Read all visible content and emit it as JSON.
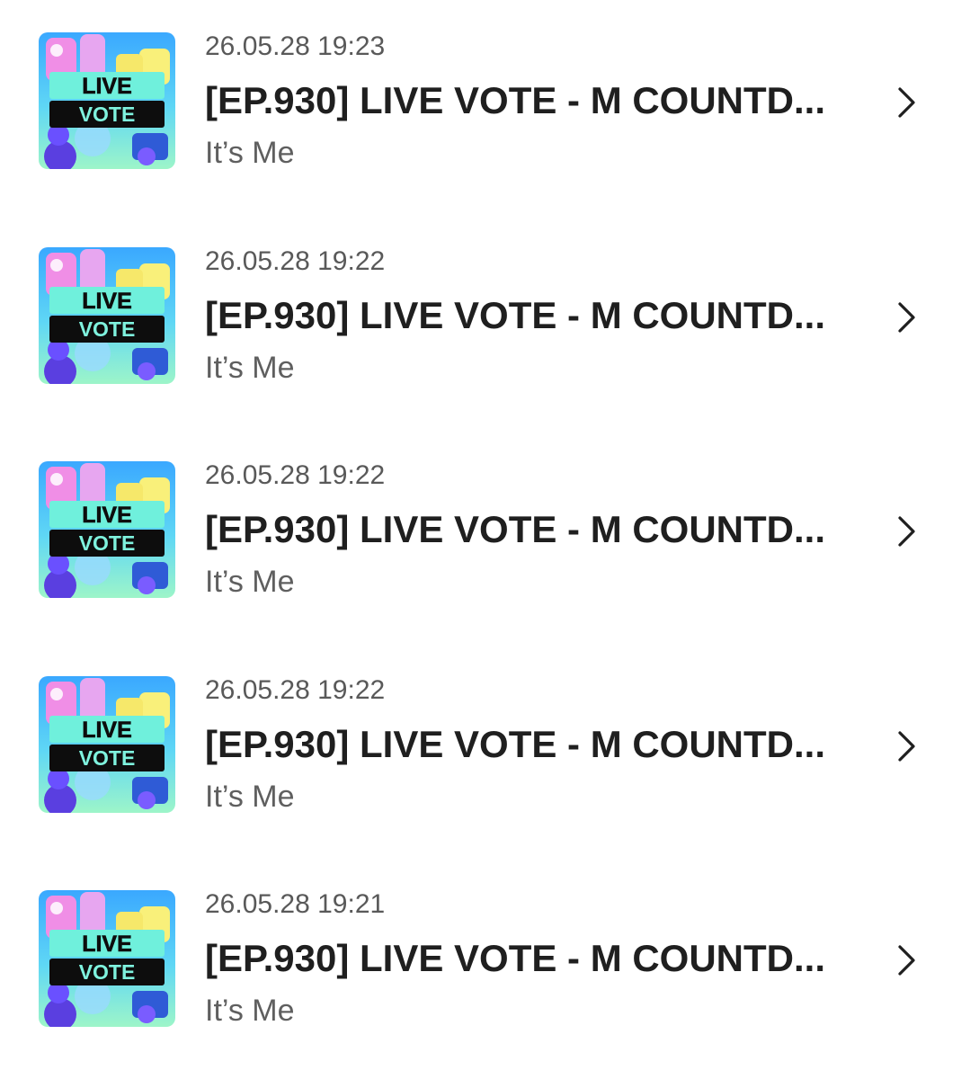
{
  "items": [
    {
      "time": "26.05.28 19:23",
      "title": "[EP.930] LIVE VOTE - M COUNTD...",
      "artist": "It’s Me",
      "thumb": {
        "line1": "LIVE",
        "line2": "VOTE"
      }
    },
    {
      "time": "26.05.28 19:22",
      "title": "[EP.930] LIVE VOTE - M COUNTD...",
      "artist": "It’s Me",
      "thumb": {
        "line1": "LIVE",
        "line2": "VOTE"
      }
    },
    {
      "time": "26.05.28 19:22",
      "title": "[EP.930] LIVE VOTE - M COUNTD...",
      "artist": "It’s Me",
      "thumb": {
        "line1": "LIVE",
        "line2": "VOTE"
      }
    },
    {
      "time": "26.05.28 19:22",
      "title": "[EP.930] LIVE VOTE - M COUNTD...",
      "artist": "It’s Me",
      "thumb": {
        "line1": "LIVE",
        "line2": "VOTE"
      }
    },
    {
      "time": "26.05.28 19:21",
      "title": "[EP.930] LIVE VOTE - M COUNTD...",
      "artist": "It’s Me",
      "thumb": {
        "line1": "LIVE",
        "line2": "VOTE"
      }
    }
  ],
  "icons": {
    "row_arrow": "chevron-right-icon"
  },
  "colors": {
    "thumb_bg_top": "#3fb6ff",
    "thumb_bg_bottom": "#7ff0d8",
    "thumb_banner": "#6ff0dc",
    "thumb_vote_bar": "#0d0d0d",
    "title_text": "#1f1f1f",
    "meta_text": "#5f5f5f"
  }
}
